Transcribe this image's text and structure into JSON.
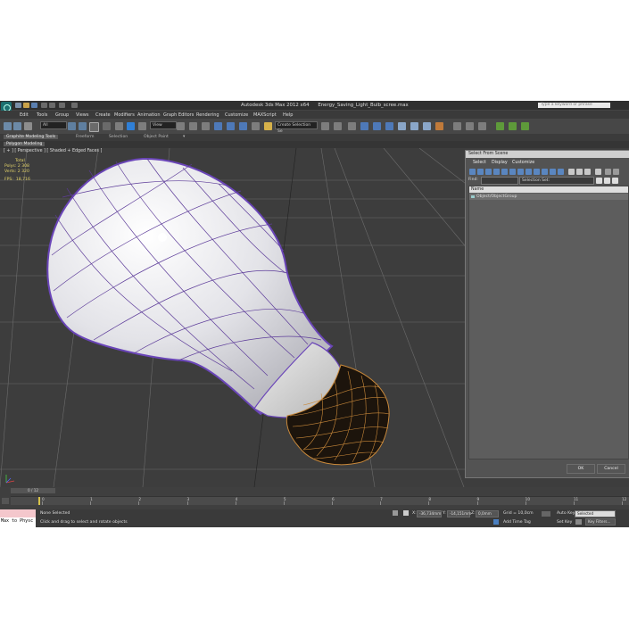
{
  "window": {
    "title": "Autodesk 3ds Max  2012 x64",
    "file": "Energy_Saving_Light_Bulb_scree.max",
    "search_placeholder": "Type a keyword or phrase"
  },
  "menu": [
    "Edit",
    "Tools",
    "Group",
    "Views",
    "Create",
    "Modifiers",
    "Animation",
    "Graph Editors",
    "Rendering",
    "Customize",
    "MAXScript",
    "Help"
  ],
  "toolbar": {
    "filter_value": "All",
    "view_value": "View",
    "selection_set_placeholder": "Create Selection Se"
  },
  "ribbon": {
    "tabs": [
      "Graphite Modeling Tools",
      "Freeform",
      "Selection",
      "Object Paint"
    ],
    "sub_label": "Polygon Modeling"
  },
  "viewport": {
    "label": "[ + ] [ Perspective ] [ Shaded + Edged Faces ]",
    "stats": {
      "total_label": "Total",
      "polys_label": "Polys:",
      "polys_value": "2 308",
      "verts_label": "Verts:",
      "verts_value": "2 320",
      "fps_label": "FPS:",
      "fps_value": "18,716"
    }
  },
  "dialog": {
    "title": "Select From Scene",
    "menu": [
      "Select",
      "Display",
      "Customize"
    ],
    "find_label": "Find:",
    "selection_set_label": "Selection Set:",
    "column_name": "Name",
    "rows": [
      "Object/ObjectGroup"
    ],
    "ok_label": "OK",
    "cancel_label": "Cancel"
  },
  "timeline": {
    "frame_slider": "0 / 12",
    "ticks": [
      "0",
      "1",
      "2",
      "3",
      "4",
      "5",
      "6",
      "7",
      "8",
      "9",
      "10",
      "11",
      "12"
    ]
  },
  "status": {
    "maxscript_text": "Max to Physc",
    "selection": "None Selected",
    "prompt": "Click and drag to select and rotate objects",
    "x_label": "X:",
    "x_value": "-36,734mm",
    "y_label": "Y:",
    "y_value": "-14,151mm",
    "z_label": "Z:",
    "z_value": "0,0mm",
    "grid": "Grid = 10,0cm",
    "auto_key": "Auto Key",
    "set_key": "Set Key",
    "key_mode": "Selected",
    "key_filters": "Key Filters...",
    "add_time_tag": "Add Time Tag"
  },
  "colors": {
    "wire_body": "#5e3d9a",
    "wire_base": "#c8883a",
    "bulb_fill": "#e6e6ea"
  }
}
